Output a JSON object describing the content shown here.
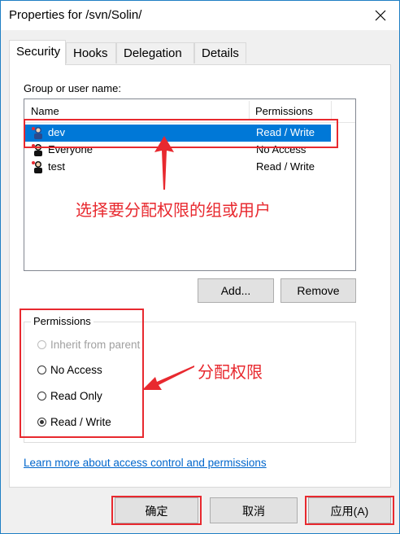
{
  "window": {
    "title": "Properties for /svn/Solin/"
  },
  "tabs": [
    {
      "label": "Security",
      "active": true
    },
    {
      "label": "Hooks",
      "active": false
    },
    {
      "label": "Delegation",
      "active": false
    },
    {
      "label": "Details",
      "active": false
    }
  ],
  "security": {
    "group_label": "Group or user name:",
    "columns": {
      "name": "Name",
      "permissions": "Permissions"
    },
    "rows": [
      {
        "name": "dev",
        "permission": "Read / Write",
        "selected": true
      },
      {
        "name": "Everyone",
        "permission": "No Access",
        "selected": false
      },
      {
        "name": "test",
        "permission": "Read / Write",
        "selected": false
      }
    ],
    "add_button": "Add...",
    "remove_button": "Remove",
    "permissions": {
      "title": "Permissions",
      "options": [
        {
          "label": "Inherit from parent",
          "disabled": true,
          "checked": false
        },
        {
          "label": "No Access",
          "disabled": false,
          "checked": false
        },
        {
          "label": "Read Only",
          "disabled": false,
          "checked": false
        },
        {
          "label": "Read / Write",
          "disabled": false,
          "checked": true
        }
      ]
    },
    "link": "Learn more about access control and permissions"
  },
  "annotations": {
    "select_group": "选择要分配权限的组或用户",
    "assign": "分配权限"
  },
  "footer": {
    "ok": "确定",
    "cancel": "取消",
    "apply": "应用(A)"
  },
  "colors": {
    "selection": "#0078d7",
    "annotation_red": "#e8292f",
    "link": "#0066cc"
  }
}
